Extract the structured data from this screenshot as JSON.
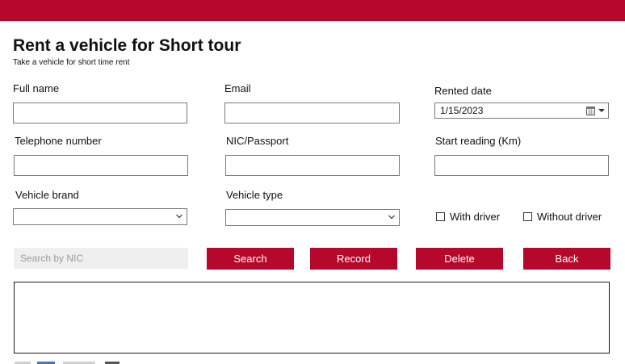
{
  "form": {
    "title": "Rent a vehicle for Short tour",
    "subtitle": "Take a vehicle for short time rent"
  },
  "fields": {
    "full_name": {
      "label": "Full name",
      "value": ""
    },
    "email": {
      "label": "Email",
      "value": ""
    },
    "rented_date": {
      "label": "Rented date",
      "value": "1/15/2023"
    },
    "telephone": {
      "label": "Telephone number",
      "value": ""
    },
    "nic_passport": {
      "label": "NIC/Passport",
      "value": ""
    },
    "start_reading": {
      "label": "Start reading (Km)",
      "value": ""
    },
    "vehicle_brand": {
      "label": "Vehicle brand",
      "value": ""
    },
    "vehicle_type": {
      "label": "Vehicle type",
      "value": ""
    }
  },
  "options": {
    "with_driver": {
      "label": "With driver",
      "checked": false
    },
    "without_driver": {
      "label": "Without driver",
      "checked": false
    }
  },
  "search": {
    "placeholder": "Search by NIC",
    "value": ""
  },
  "buttons": {
    "search": "Search",
    "record": "Record",
    "delete": "Delete",
    "back": "Back"
  },
  "colors": {
    "accent": "#b5082b",
    "search_bg": "#efefef"
  },
  "icons": {
    "dropdown": "chevron-down-icon",
    "calendar": "calendar-icon"
  }
}
